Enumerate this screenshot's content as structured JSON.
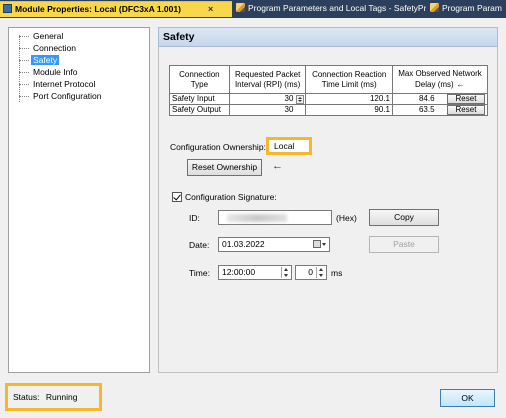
{
  "tabs": [
    {
      "label": "Module Properties: Local (DFC3xA 1.001)",
      "active": true,
      "icon": "module-icon"
    },
    {
      "label": "Program Parameters and Local Tags - SafetyProgram",
      "active": false,
      "icon": "pencil-icon"
    },
    {
      "label": "Program Param",
      "active": false,
      "icon": "pencil-icon"
    }
  ],
  "tab_close": "×",
  "tree": {
    "items": [
      "General",
      "Connection",
      "Safety",
      "Module Info",
      "Internet Protocol",
      "Port Configuration"
    ],
    "selected": "Safety"
  },
  "panel_title": "Safety",
  "connection_table": {
    "headers": [
      "Connection Type",
      "Requested Packet Interval (RPI) (ms)",
      "Connection Reaction Time Limit (ms)",
      "Max Observed Network Delay (ms)"
    ],
    "header_arrow": "←",
    "rows": [
      {
        "type": "Safety Input",
        "rpi": "30",
        "reaction": "120.1",
        "delay": "84.6",
        "reset": "Reset"
      },
      {
        "type": "Safety Output",
        "rpi": "30",
        "reaction": "90.1",
        "delay": "63.5",
        "reset": "Reset"
      }
    ]
  },
  "ownership": {
    "label": "Configuration Ownership:",
    "value": "Local",
    "reset_button": "Reset Ownership",
    "arrow": "←"
  },
  "signature": {
    "checkbox_label": "Configuration Signature:",
    "checked": true,
    "id_label": "ID:",
    "id_suffix": "(Hex)",
    "copy_button": "Copy",
    "date_label": "Date:",
    "date_value": "01.03.2022",
    "paste_button": "Paste",
    "time_label": "Time:",
    "time_value": "12:00:00",
    "ms_value": "0",
    "ms_unit": "ms"
  },
  "status": {
    "label": "Status:",
    "value": "Running"
  },
  "ok_button": "OK",
  "colors": {
    "highlight": "#f5b82a",
    "selection": "#3399ff",
    "active_tab": "#f8d74a",
    "tab_strip": "#2c3f5c"
  }
}
